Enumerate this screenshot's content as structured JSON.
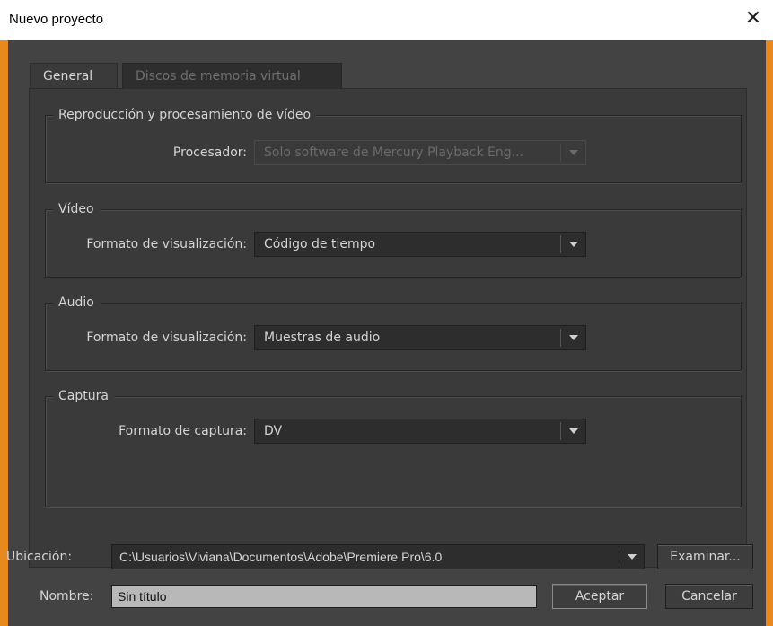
{
  "window": {
    "title": "Nuevo proyecto",
    "close_glyph": "✕"
  },
  "tabs": [
    {
      "label": "General",
      "active": true
    },
    {
      "label": "Discos de memoria virtual",
      "active": false
    }
  ],
  "groups": {
    "video_processing": {
      "title": "Reproducción y procesamiento de vídeo",
      "label": "Procesador:",
      "value": "Solo software de Mercury Playback Eng...",
      "disabled": true
    },
    "video": {
      "title": "Vídeo",
      "label": "Formato de visualización:",
      "value": "Código de tiempo"
    },
    "audio": {
      "title": "Audio",
      "label": "Formato de visualización:",
      "value": "Muestras de audio"
    },
    "capture": {
      "title": "Captura",
      "label": "Formato de captura:",
      "value": "DV"
    }
  },
  "footer": {
    "location_label": "Ubicación:",
    "location_value": "C:\\Usuarios\\Viviana\\Documentos\\Adobe\\Premiere Pro\\6.0",
    "browse_label": "Examinar...",
    "name_label": "Nombre:",
    "name_value": "Sin título",
    "accept_label": "Aceptar",
    "cancel_label": "Cancelar"
  },
  "colors": {
    "background_accent": "#e8891e",
    "dialog_bg": "#434343",
    "panel_bg": "#3a3a3a",
    "text": "#d4d4d4"
  }
}
